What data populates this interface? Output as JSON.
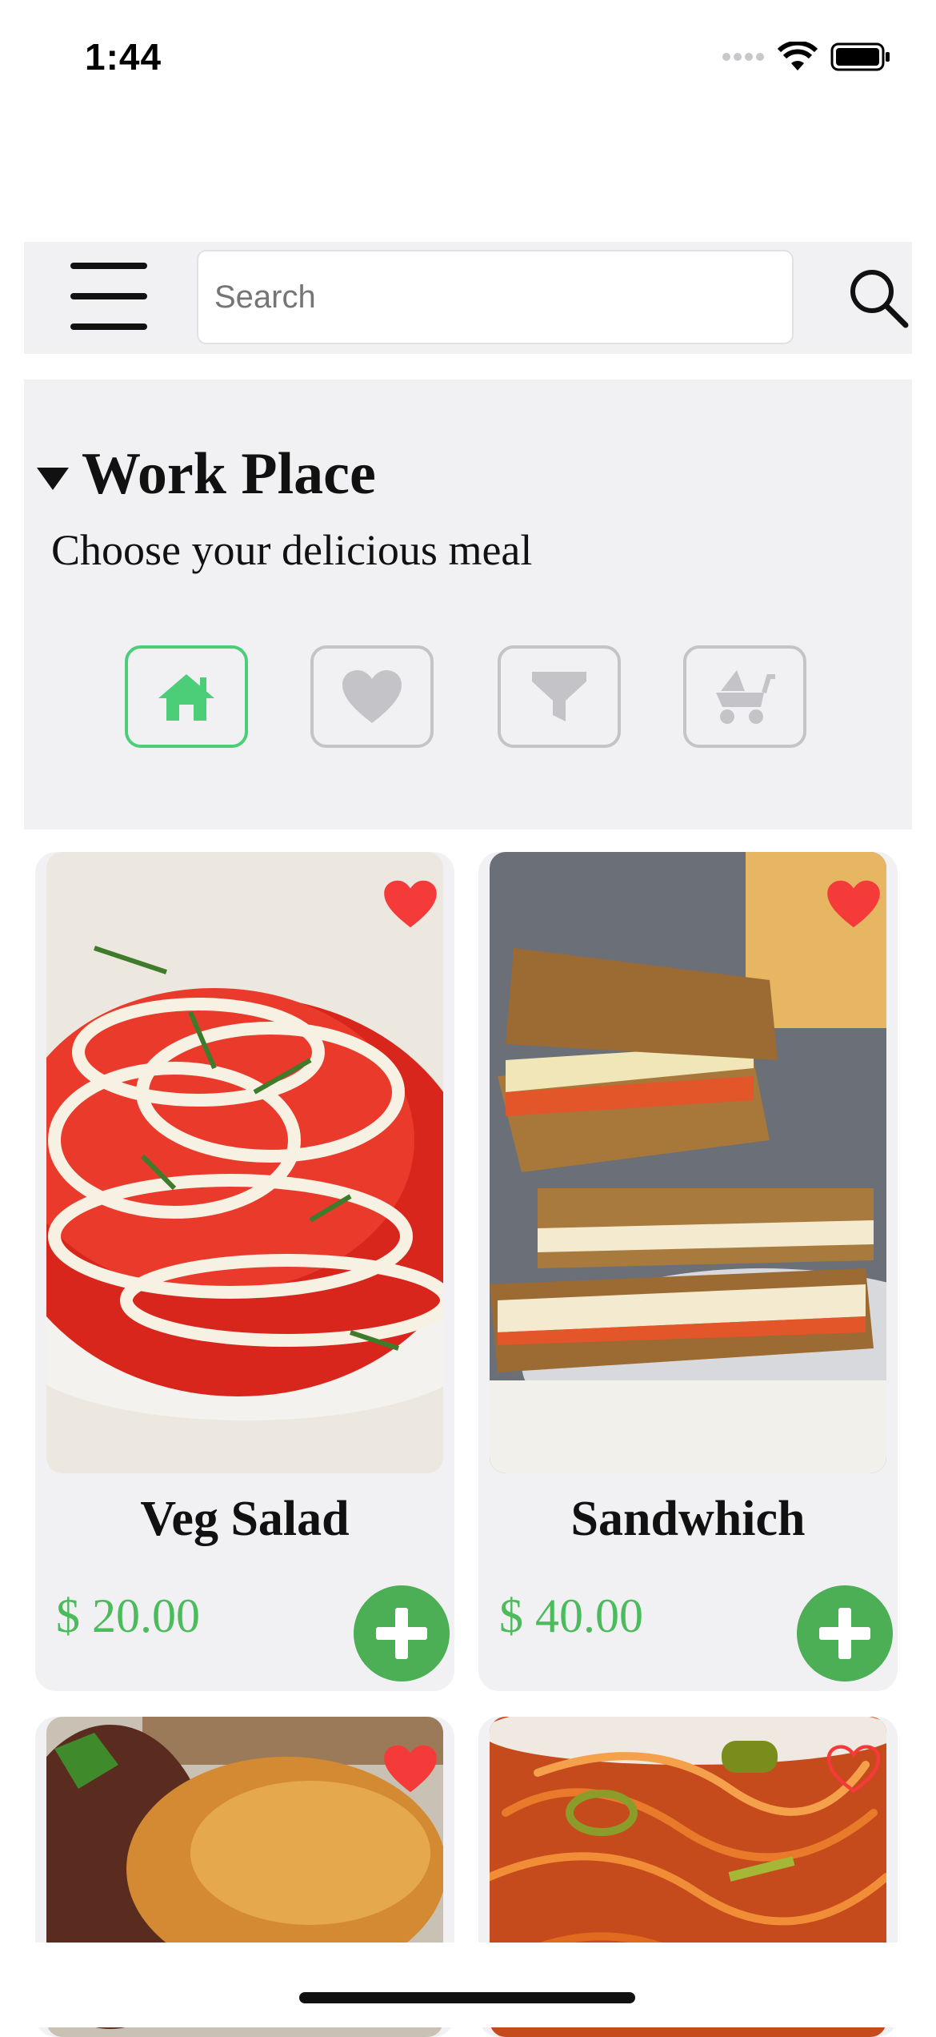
{
  "status_bar": {
    "time": "1:44"
  },
  "search": {
    "placeholder": "Search"
  },
  "header": {
    "title": "Work Place",
    "subtitle": "Choose your delicious meal"
  },
  "tabs": [
    {
      "icon": "home-icon",
      "active": true
    },
    {
      "icon": "heart-icon",
      "active": false
    },
    {
      "icon": "filter-icon",
      "active": false
    },
    {
      "icon": "stroller-icon",
      "active": false
    }
  ],
  "items": [
    {
      "name": "Veg Salad",
      "price": "$ 20.00",
      "favorite": true
    },
    {
      "name": "Sandwhich",
      "price": "$ 40.00",
      "favorite": true
    },
    {
      "name": "",
      "price": "",
      "favorite": true
    },
    {
      "name": "",
      "price": "",
      "favorite": false
    }
  ],
  "colors": {
    "accent": "#4cae55",
    "price": "#4cbb5c",
    "active_tab": "#4ccd78",
    "heart": "#f53a3a"
  }
}
